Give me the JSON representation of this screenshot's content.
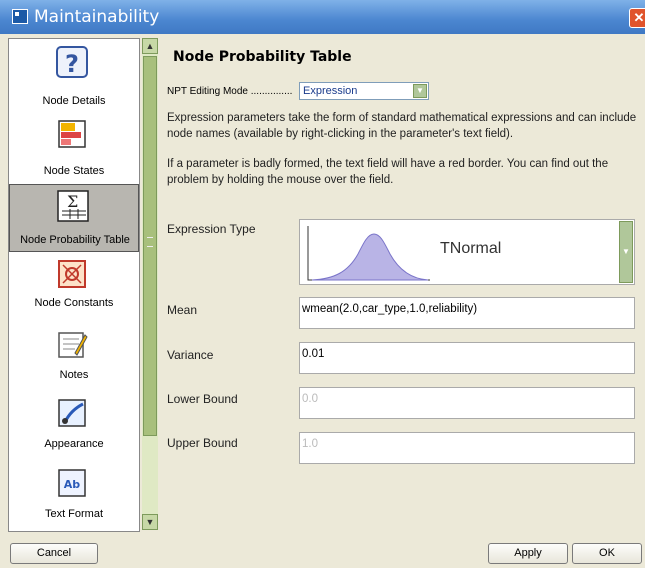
{
  "window": {
    "title": "Maintainability",
    "close_glyph": "✕"
  },
  "sidebar": {
    "items": [
      {
        "label": "Node Details",
        "icon": "question-mark-icon"
      },
      {
        "label": "Node States",
        "icon": "states-icon"
      },
      {
        "label": "Node Probability Table",
        "icon": "sigma-table-icon",
        "selected": true
      },
      {
        "label": "Node Constants",
        "icon": "constants-icon"
      },
      {
        "label": "Notes",
        "icon": "notepad-icon"
      },
      {
        "label": "Appearance",
        "icon": "brush-icon"
      },
      {
        "label": "Text Format",
        "icon": "text-format-icon"
      }
    ],
    "scroll_up_glyph": "▲",
    "scroll_down_glyph": "▼"
  },
  "main": {
    "heading": "Node Probability Table",
    "npt_mode_label": "NPT Editing Mode ...............",
    "npt_mode_value": "Expression",
    "description_1": "Expression parameters take the form of standard mathematical expressions and can include node names (available by right-clicking in the parameter's text field).",
    "description_2": "If a parameter is badly formed, the text field will have a red border. You can find out the problem by holding the mouse over the field.",
    "expression_type_label": "Expression Type",
    "expression_type_value": "TNormal",
    "fields": [
      {
        "label": "Mean",
        "value": "wmean(2.0,car_type,1.0,reliability)",
        "enabled": true
      },
      {
        "label": "Variance",
        "value": "0.01",
        "enabled": true
      },
      {
        "label": "Lower Bound",
        "value": "0.0",
        "enabled": false
      },
      {
        "label": "Upper Bound",
        "value": "1.0",
        "enabled": false
      }
    ]
  },
  "buttons": {
    "cancel": "Cancel",
    "apply": "Apply",
    "ok": "OK"
  },
  "colors": {
    "titlebar": "#4b86d0",
    "close": "#e0542c",
    "selected_item": "#b8b6b0",
    "curve": "#b9b4e6"
  }
}
